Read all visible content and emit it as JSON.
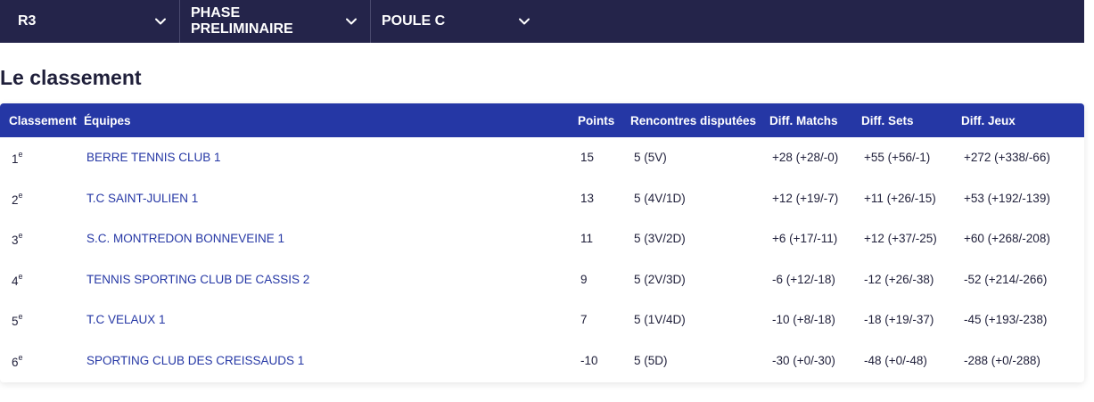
{
  "filters": [
    {
      "label": "R3"
    },
    {
      "label": "PHASE PRELIMINAIRE"
    },
    {
      "label": "POULE C"
    }
  ],
  "page_title": "Le classement",
  "table": {
    "headers": {
      "rank": "Classement",
      "team": "Équipes",
      "points": "Points",
      "meetings": "Rencontres disputées",
      "diff_matchs": "Diff. Matchs",
      "diff_sets": "Diff. Sets",
      "diff_jeux": "Diff. Jeux"
    },
    "rows": [
      {
        "rank": "1",
        "suffix": "e",
        "team": "BERRE TENNIS CLUB 1",
        "points": "15",
        "meetings": "5 (5V)",
        "diff_matchs": "+28 (+28/-0)",
        "diff_sets": "+55 (+56/-1)",
        "diff_jeux": "+272 (+338/-66)"
      },
      {
        "rank": "2",
        "suffix": "e",
        "team": "T.C SAINT-JULIEN 1",
        "points": "13",
        "meetings": "5 (4V/1D)",
        "diff_matchs": "+12 (+19/-7)",
        "diff_sets": "+11 (+26/-15)",
        "diff_jeux": "+53 (+192/-139)"
      },
      {
        "rank": "3",
        "suffix": "e",
        "team": "S.C. MONTREDON BONNEVEINE 1",
        "points": "11",
        "meetings": "5 (3V/2D)",
        "diff_matchs": "+6 (+17/-11)",
        "diff_sets": "+12 (+37/-25)",
        "diff_jeux": "+60 (+268/-208)"
      },
      {
        "rank": "4",
        "suffix": "e",
        "team": "TENNIS SPORTING CLUB DE CASSIS 2",
        "points": "9",
        "meetings": "5 (2V/3D)",
        "diff_matchs": "-6 (+12/-18)",
        "diff_sets": "-12 (+26/-38)",
        "diff_jeux": "-52 (+214/-266)"
      },
      {
        "rank": "5",
        "suffix": "e",
        "team": "T.C VELAUX 1",
        "points": "7",
        "meetings": "5 (1V/4D)",
        "diff_matchs": "-10 (+8/-18)",
        "diff_sets": "-18 (+19/-37)",
        "diff_jeux": "-45 (+193/-238)"
      },
      {
        "rank": "6",
        "suffix": "e",
        "team": "SPORTING CLUB DES CREISSAUDS 1",
        "points": "-10",
        "meetings": "5 (5D)",
        "diff_matchs": "-30 (+0/-30)",
        "diff_sets": "-48 (+0/-48)",
        "diff_jeux": "-288 (+0/-288)"
      }
    ]
  },
  "colors": {
    "filter_bar_bg": "#24244a",
    "table_header_bg": "#2537a5",
    "team_link": "#2537a5",
    "text": "#1f1f3a"
  },
  "icons": {
    "dropdown": "chevron-down-icon"
  }
}
